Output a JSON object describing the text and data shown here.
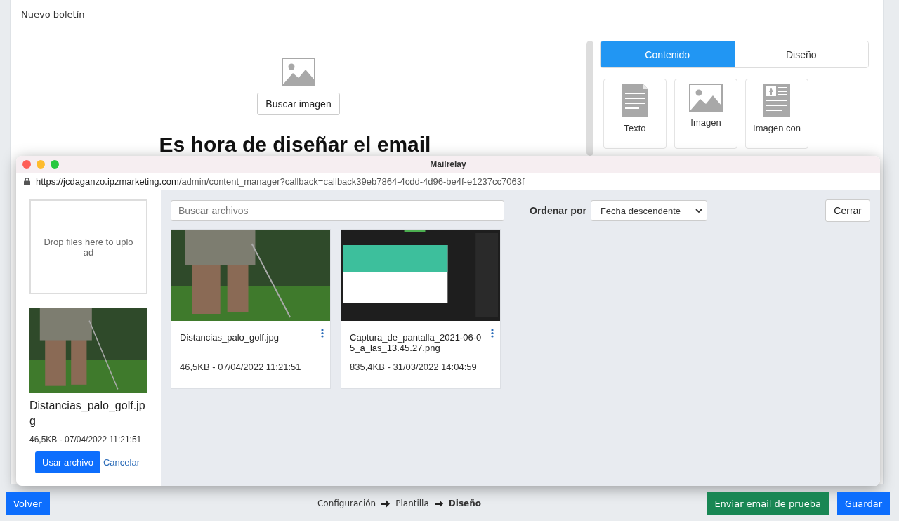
{
  "page": {
    "title": "Nuevo boletín"
  },
  "editor": {
    "image_button": "Buscar imagen",
    "headline": "Es hora de diseñar el email"
  },
  "sidebar": {
    "tabs": [
      {
        "label": "Contenido",
        "selected": true
      },
      {
        "label": "Diseño",
        "selected": false
      }
    ],
    "blocks": [
      {
        "kind": "text",
        "label": "Texto"
      },
      {
        "kind": "image",
        "label": "Imagen"
      },
      {
        "kind": "image-caption",
        "label": "Imagen con"
      }
    ]
  },
  "popup": {
    "title": "Mailrelay",
    "url_host": "https://jcdaganzo.ipzmarketing.com",
    "url_path": "/admin/content_manager?callback=callback39eb7864-4cdd-4d96-be4f-e1237cc7063f",
    "dropzone": "Drop files here to upload",
    "selected_file": {
      "kind": "golf",
      "name": "Distancias_palo_golf.jpg",
      "meta": "46,5KB - 07/04/2022 11:21:51",
      "use_button": "Usar archivo",
      "cancel_link": "Cancelar"
    },
    "search": {
      "placeholder": "Buscar archivos"
    },
    "sort": {
      "label": "Ordenar por",
      "value": "Fecha descendente"
    },
    "close_button": "Cerrar",
    "files": [
      {
        "kind": "golf",
        "name": "Distancias_palo_golf.jpg",
        "meta": "46,5KB - 07/04/2022 11:21:51"
      },
      {
        "kind": "screenshot",
        "name": "Captura_de_pantalla_2021-06-05_a_las_13.45.27.png",
        "meta": "835,4KB - 31/03/2022 14:04:59"
      }
    ]
  },
  "footer": {
    "back_button": "Volver",
    "steps": [
      {
        "label": "Configuración",
        "current": false
      },
      {
        "label": "Plantilla",
        "current": false
      },
      {
        "label": "Diseño",
        "current": true
      }
    ],
    "test_button": "Enviar email de prueba",
    "save_button": "Guardar"
  }
}
